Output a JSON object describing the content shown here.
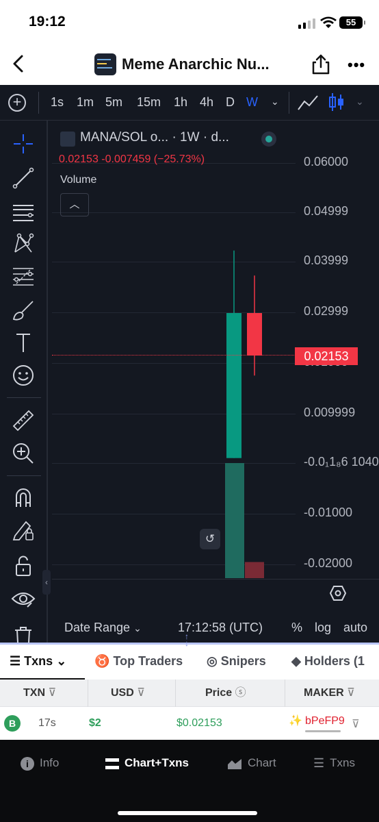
{
  "status_bar": {
    "time": "19:12",
    "battery": "55"
  },
  "header": {
    "title": "Meme Anarchic Nu..."
  },
  "timeframes": [
    {
      "label": "1s",
      "active": false
    },
    {
      "label": "1m",
      "active": false
    },
    {
      "label": "5m",
      "active": false
    },
    {
      "label": "15m",
      "active": false
    },
    {
      "label": "1h",
      "active": false
    },
    {
      "label": "4h",
      "active": false
    },
    {
      "label": "D",
      "active": false
    },
    {
      "label": "W",
      "active": true
    }
  ],
  "chart_legend": {
    "title": "MANA/SOL o... · 1W · d...",
    "ohlc_text": "0.02153 -0.007459 (−25.73%)",
    "volume_label": "Volume"
  },
  "chart_data": {
    "type": "candlestick",
    "pair": "MANA/SOL",
    "interval": "1W",
    "y_tick_labels": [
      "0.06000",
      "0.04999",
      "0.03999",
      "0.02999",
      "0.01999",
      "0.009999",
      "-0.0₁1₈6 1040",
      "-0.01000",
      "-0.02000"
    ],
    "ylim": [
      -0.022,
      0.062
    ],
    "current_price": "0.02153",
    "change": "-0.007459",
    "change_pct": "-25.73%",
    "candles": [
      {
        "open": 0.001,
        "close": 0.03,
        "high": 0.0425,
        "low": 0.001,
        "color": "up"
      },
      {
        "open": 0.03,
        "close": 0.0215,
        "high": 0.0375,
        "low": 0.0175,
        "color": "down"
      }
    ],
    "volume_bars": [
      {
        "value": 1.0,
        "color": "up"
      },
      {
        "value": 0.14,
        "color": "down"
      }
    ]
  },
  "date_bar": {
    "date_range": "Date Range",
    "clock": "17:12:58 (UTC)",
    "percent": "%",
    "log": "log",
    "auto": "auto"
  },
  "tabs": [
    {
      "label": "Txns",
      "active": true
    },
    {
      "label": "Top Traders",
      "active": false
    },
    {
      "label": "Snipers",
      "active": false
    },
    {
      "label": "Holders (1",
      "active": false
    }
  ],
  "table": {
    "columns": [
      "TXN",
      "USD",
      "Price",
      "MAKER"
    ],
    "rows": [
      {
        "type": "B",
        "age": "17s",
        "usd": "$2",
        "price": "$0.02153",
        "maker": "bPeFP9"
      }
    ]
  },
  "bottom_nav": [
    {
      "label": "Info",
      "active": false
    },
    {
      "label": "Chart+Txns",
      "active": true
    },
    {
      "label": "Chart",
      "active": false
    },
    {
      "label": "Txns",
      "active": false
    }
  ],
  "colors": {
    "up": "#089981",
    "down": "#f23645",
    "accent": "#2962ff",
    "buy_badge": "#2e9e5b"
  }
}
